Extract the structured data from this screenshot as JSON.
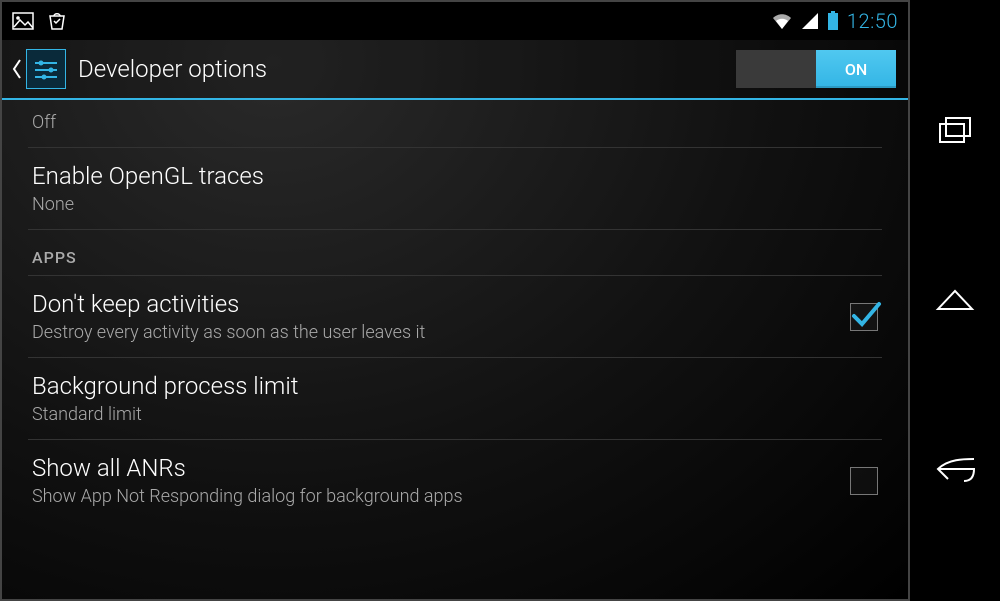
{
  "status": {
    "clock": "12:50"
  },
  "actionbar": {
    "title": "Developer options",
    "switch_label": "ON"
  },
  "section_apps": "APPS",
  "items": {
    "prev_value": "Off",
    "opengl": {
      "title": "Enable OpenGL traces",
      "value": "None"
    },
    "dont_keep": {
      "title": "Don't keep activities",
      "sub": "Destroy every activity as soon as the user leaves it",
      "checked": true
    },
    "bg_limit": {
      "title": "Background process limit",
      "value": "Standard limit"
    },
    "show_anr": {
      "title": "Show all ANRs",
      "sub": "Show App Not Responding dialog for background apps",
      "checked": false
    }
  }
}
